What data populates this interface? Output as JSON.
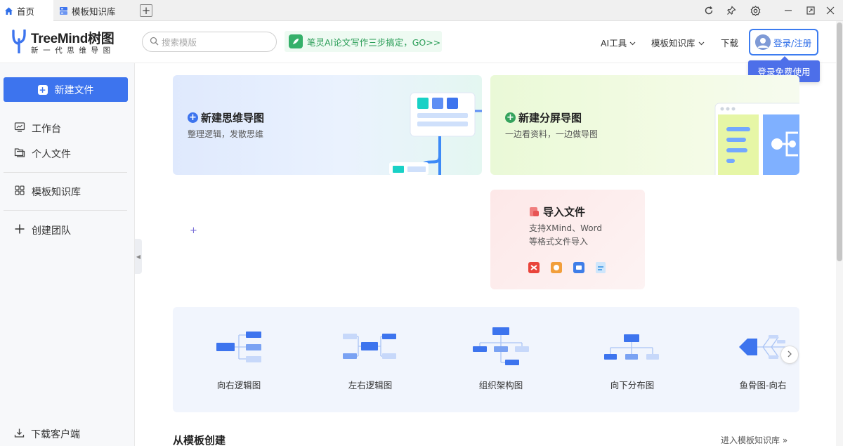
{
  "tabs": [
    {
      "label": "首页",
      "icon": "home-icon",
      "active": true
    },
    {
      "label": "模板知识库",
      "icon": "template-icon",
      "active": false
    }
  ],
  "window_controls": [
    "refresh-icon",
    "pin-icon",
    "settings-icon",
    "minimize-icon",
    "maximize-icon",
    "close-icon"
  ],
  "header": {
    "logo_title": "TreeMind树图",
    "logo_sub": "新一代思维导图",
    "search_placeholder": "搜索模版",
    "promo_text": "笔灵AI论文写作三步搞定，GO>>",
    "nav": [
      {
        "label": "AI工具",
        "dropdown": true
      },
      {
        "label": "模板知识库",
        "dropdown": true
      },
      {
        "label": "下载",
        "dropdown": false
      }
    ],
    "login_label": "登录/注册",
    "tooltip": "登录免费使用"
  },
  "sidebar": {
    "new_file": "新建文件",
    "items": [
      {
        "label": "工作台",
        "icon": "monitor-icon"
      },
      {
        "label": "个人文件",
        "icon": "folder-icon"
      },
      {
        "label": "模板知识库",
        "icon": "grid-icon"
      },
      {
        "label": "创建团队",
        "icon": "plus-icon"
      }
    ],
    "download_client": "下载客户端"
  },
  "cards": {
    "mind": {
      "title": "新建思维导图",
      "desc": "整理逻辑，发散思维"
    },
    "split": {
      "title": "新建分屏导图",
      "desc": "一边看资料，一边做导图"
    },
    "import": {
      "title": "导入文件",
      "desc_line1": "支持XMind、Word",
      "desc_line2": "等格式文件导入"
    }
  },
  "templates": [
    {
      "label": "向右逻辑图"
    },
    {
      "label": "左右逻辑图"
    },
    {
      "label": "组织架构图"
    },
    {
      "label": "向下分布图"
    },
    {
      "label": "鱼骨图-向右"
    }
  ],
  "section": {
    "title": "从模板创建",
    "link": "进入模板知识库 »"
  },
  "colors": {
    "accent": "#3d74ee",
    "green": "#35b06a",
    "tooltip": "#4d6fe9"
  }
}
